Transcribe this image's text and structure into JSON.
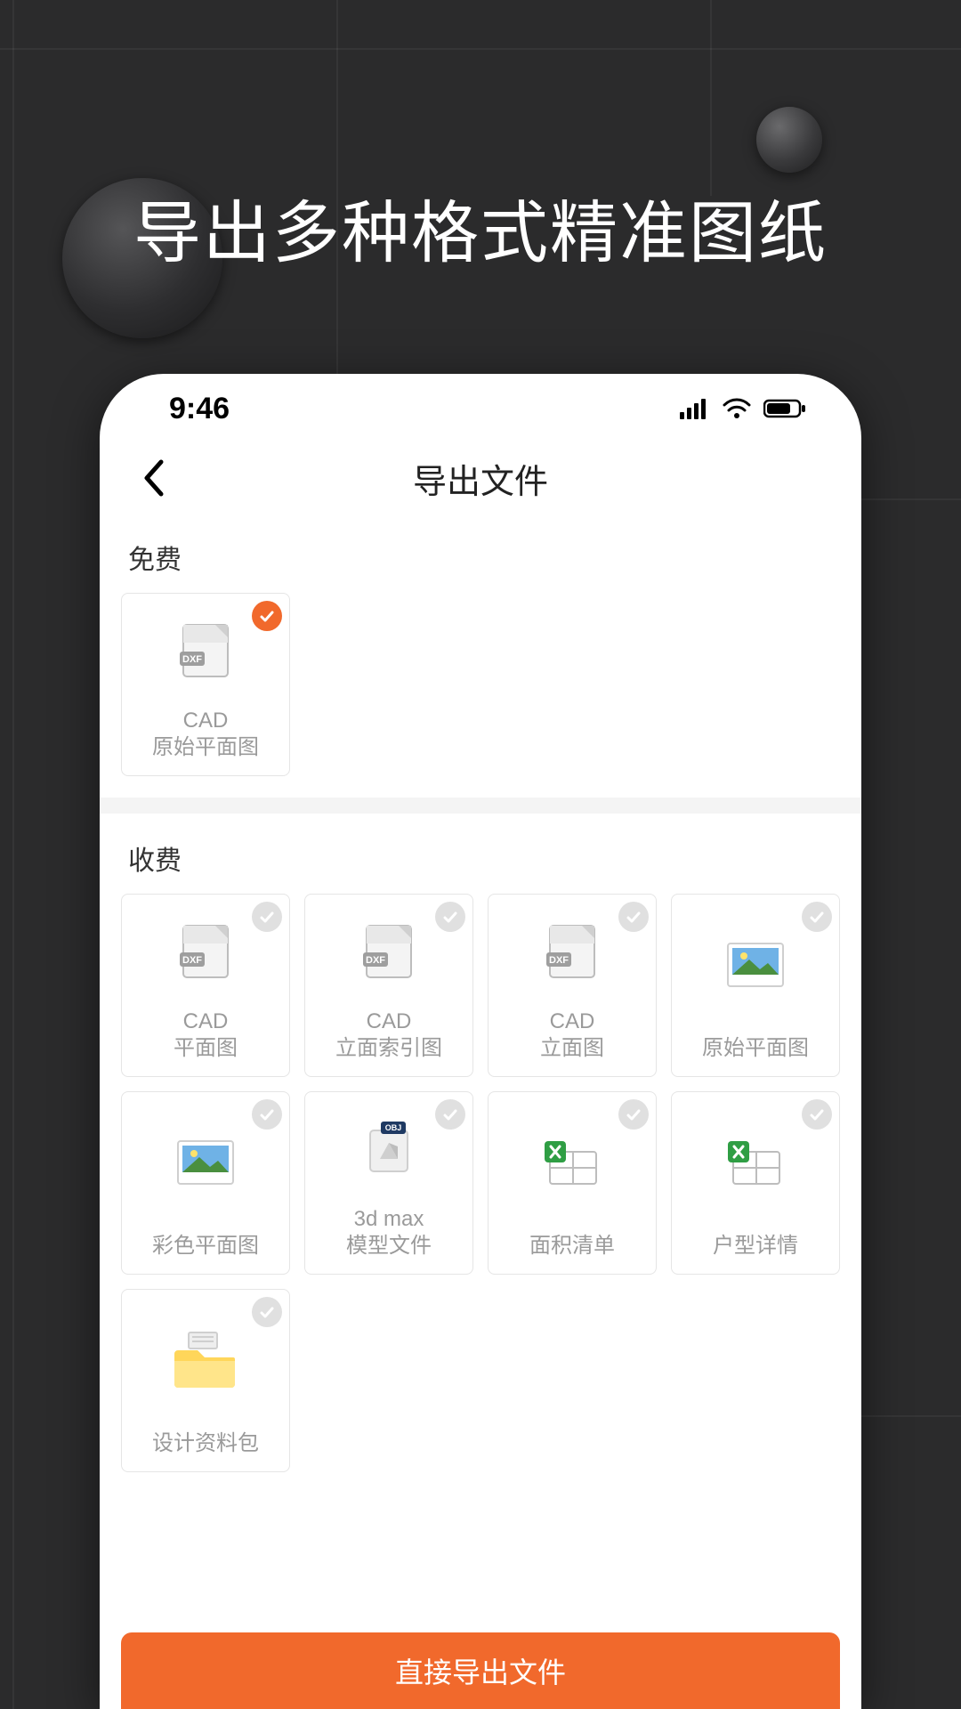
{
  "headline": "导出多种格式精准图纸",
  "status": {
    "time": "9:46"
  },
  "nav": {
    "title": "导出文件"
  },
  "sections": {
    "free": {
      "label": "免费",
      "items": [
        {
          "line1": "CAD",
          "line2": "原始平面图",
          "selected": true,
          "icon": "dxf"
        }
      ]
    },
    "paid": {
      "label": "收费",
      "items": [
        {
          "line1": "CAD",
          "line2": "平面图",
          "selected": false,
          "icon": "dxf"
        },
        {
          "line1": "CAD",
          "line2": "立面索引图",
          "selected": false,
          "icon": "dxf"
        },
        {
          "line1": "CAD",
          "line2": "立面图",
          "selected": false,
          "icon": "dxf"
        },
        {
          "line1": "",
          "line2": "原始平面图",
          "selected": false,
          "icon": "img"
        },
        {
          "line1": "",
          "line2": "彩色平面图",
          "selected": false,
          "icon": "img"
        },
        {
          "line1": "3d max",
          "line2": "模型文件",
          "selected": false,
          "icon": "obj"
        },
        {
          "line1": "",
          "line2": "面积清单",
          "selected": false,
          "icon": "xls"
        },
        {
          "line1": "",
          "line2": "户型详情",
          "selected": false,
          "icon": "xls"
        },
        {
          "line1": "",
          "line2": "设计资料包",
          "selected": false,
          "icon": "folder"
        }
      ]
    }
  },
  "button": {
    "export": "直接导出文件"
  },
  "colors": {
    "accent": "#f1692c"
  }
}
